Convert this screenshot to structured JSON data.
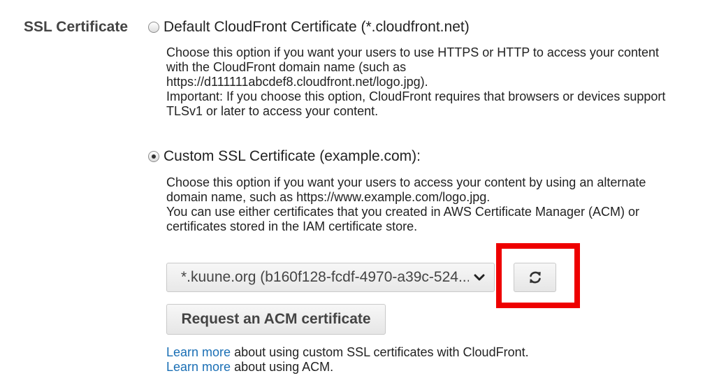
{
  "section": {
    "label": "SSL Certificate"
  },
  "default_option": {
    "label": "Default CloudFront Certificate (*.cloudfront.net)",
    "checked": false,
    "description_lines": [
      "Choose this option if you want your users to use HTTPS or HTTP to access your content",
      "with the CloudFront domain name (such as",
      "https://d111111abcdef8.cloudfront.net/logo.jpg).",
      "Important: If you choose this option, CloudFront requires that browsers or devices support",
      "TLSv1 or later to access your content."
    ]
  },
  "custom_option": {
    "label": "Custom SSL Certificate (example.com):",
    "checked": true,
    "description_lines": [
      "Choose this option if you want your users to access your content by using an alternate",
      "domain name, such as https://www.example.com/logo.jpg.",
      "You can use either certificates that you created in AWS Certificate Manager (ACM) or",
      "certificates stored in the IAM certificate store."
    ]
  },
  "certificate_select": {
    "selected_value": "*.kuune.org (b160f128-fcdf-4970-a39c-524...",
    "icon": "chevron-down-icon"
  },
  "refresh_button": {
    "icon": "refresh-icon"
  },
  "highlight": {
    "color": "#ee0000"
  },
  "request_button": {
    "label": "Request an ACM certificate"
  },
  "learn_more": [
    {
      "link_text": "Learn more",
      "text": " about using custom SSL certificates with CloudFront."
    },
    {
      "link_text": "Learn more",
      "text": " about using ACM."
    }
  ],
  "colors": {
    "link": "#1a6fb5",
    "label": "#444444"
  }
}
